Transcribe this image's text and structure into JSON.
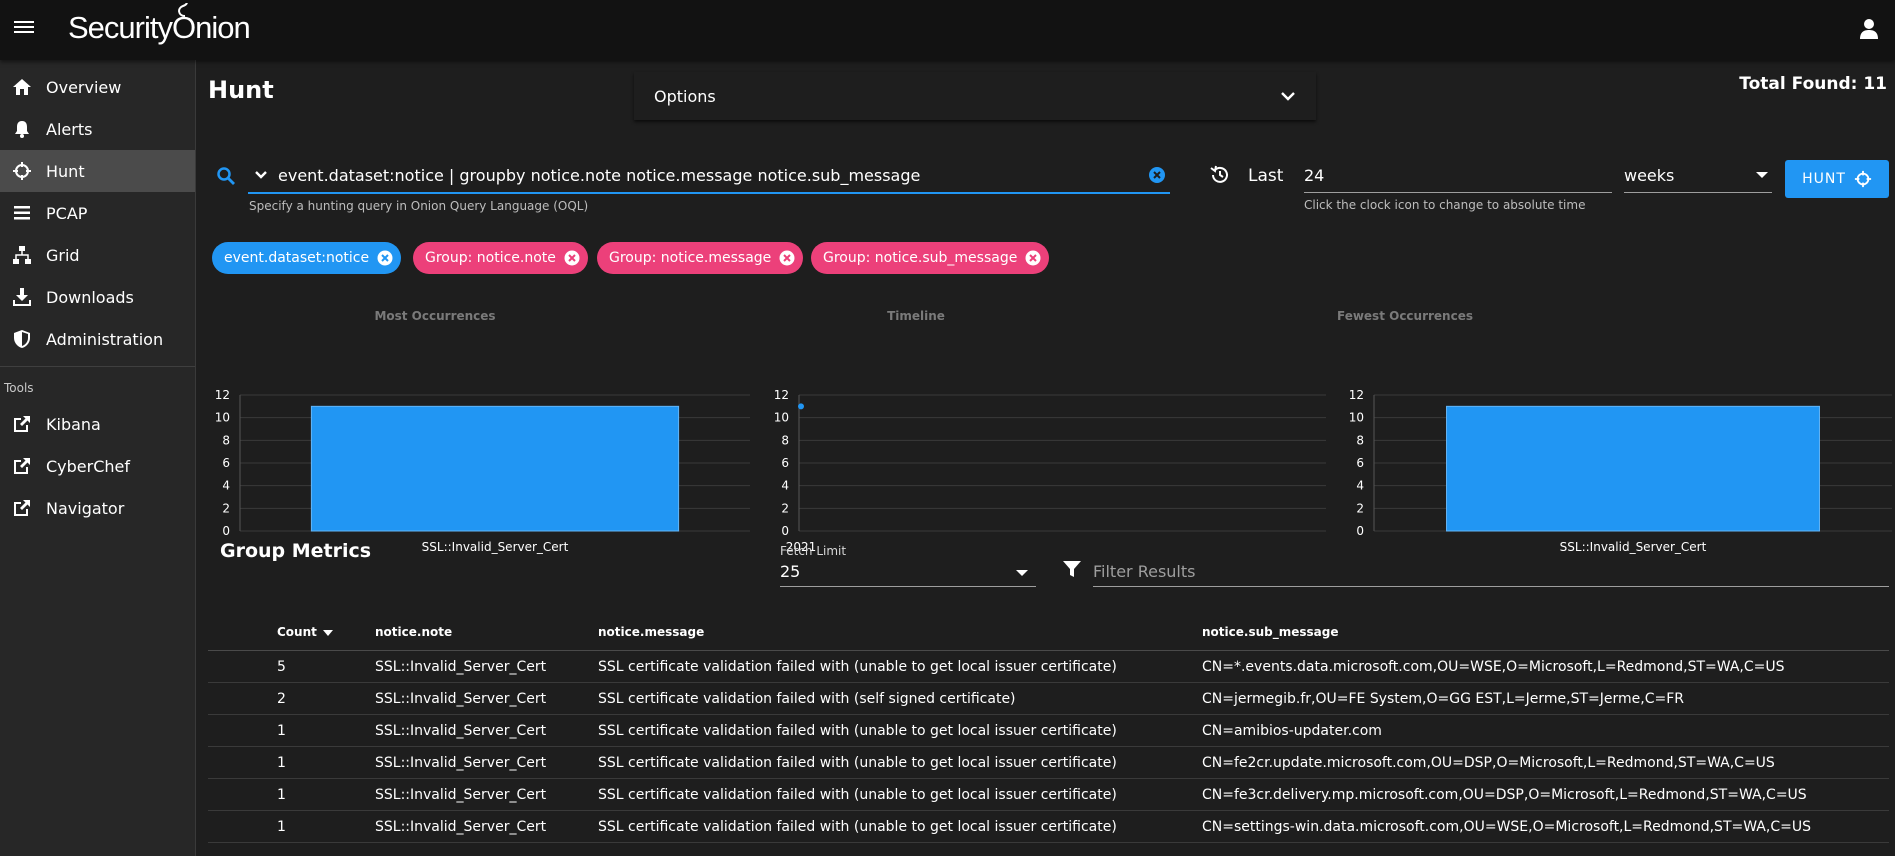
{
  "app": {
    "brand": "Security Onion"
  },
  "sidebar": {
    "items": [
      {
        "label": "Overview"
      },
      {
        "label": "Alerts"
      },
      {
        "label": "Hunt"
      },
      {
        "label": "PCAP"
      },
      {
        "label": "Grid"
      },
      {
        "label": "Downloads"
      },
      {
        "label": "Administration"
      }
    ],
    "tools_header": "Tools",
    "tools": [
      {
        "label": "Kibana"
      },
      {
        "label": "CyberChef"
      },
      {
        "label": "Navigator"
      }
    ]
  },
  "page": {
    "title": "Hunt",
    "options_label": "Options",
    "total_found": "Total Found: 11"
  },
  "query": {
    "value": "event.dataset:notice | groupby notice.note notice.message notice.sub_message",
    "hint": "Specify a hunting query in Onion Query Language (OQL)"
  },
  "time": {
    "last_label": "Last",
    "value": "24",
    "unit": "weeks",
    "hint": "Click the clock icon to change to absolute time",
    "hunt_label": "HUNT"
  },
  "chips": [
    {
      "label": "event.dataset:notice",
      "color": "#2196f3"
    },
    {
      "label": "Group: notice.note",
      "color": "#ec407a"
    },
    {
      "label": "Group: notice.message",
      "color": "#ec407a"
    },
    {
      "label": "Group: notice.sub_message",
      "color": "#ec407a"
    }
  ],
  "chart_data": [
    {
      "type": "bar",
      "title": "Most Occurrences",
      "categories": [
        "SSL::Invalid_Server_Cert"
      ],
      "values": [
        11
      ],
      "ylim": [
        0,
        12
      ],
      "yticks": [
        "0",
        "2",
        "4",
        "6",
        "8",
        "10",
        "12"
      ],
      "color": "#2196f3"
    },
    {
      "type": "scatter",
      "title": "Timeline",
      "x": [
        "2021"
      ],
      "values": [
        11
      ],
      "ylim": [
        0,
        12
      ],
      "yticks": [
        "0",
        "2",
        "4",
        "6",
        "8",
        "10",
        "12"
      ],
      "color": "#2196f3"
    },
    {
      "type": "bar",
      "title": "Fewest Occurrences",
      "categories": [
        "SSL::Invalid_Server_Cert"
      ],
      "values": [
        11
      ],
      "ylim": [
        0,
        12
      ],
      "yticks": [
        "0",
        "2",
        "4",
        "6",
        "8",
        "10",
        "12"
      ],
      "color": "#2196f3"
    }
  ],
  "metrics": {
    "title": "Group Metrics",
    "fetch_label": "Fetch Limit",
    "fetch_value": "25",
    "filter_placeholder": "Filter Results",
    "columns": [
      "Count",
      "notice.note",
      "notice.message",
      "notice.sub_message"
    ],
    "rows": [
      [
        "5",
        "SSL::Invalid_Server_Cert",
        "SSL certificate validation failed with (unable to get local issuer certificate)",
        "CN=*.events.data.microsoft.com,OU=WSE,O=Microsoft,L=Redmond,ST=WA,C=US"
      ],
      [
        "2",
        "SSL::Invalid_Server_Cert",
        "SSL certificate validation failed with (self signed certificate)",
        "CN=jermegib.fr,OU=FE System,O=GG EST,L=Jerme,ST=Jerme,C=FR"
      ],
      [
        "1",
        "SSL::Invalid_Server_Cert",
        "SSL certificate validation failed with (unable to get local issuer certificate)",
        "CN=amibios-updater.com"
      ],
      [
        "1",
        "SSL::Invalid_Server_Cert",
        "SSL certificate validation failed with (unable to get local issuer certificate)",
        "CN=fe2cr.update.microsoft.com,OU=DSP,O=Microsoft,L=Redmond,ST=WA,C=US"
      ],
      [
        "1",
        "SSL::Invalid_Server_Cert",
        "SSL certificate validation failed with (unable to get local issuer certificate)",
        "CN=fe3cr.delivery.mp.microsoft.com,OU=DSP,O=Microsoft,L=Redmond,ST=WA,C=US"
      ],
      [
        "1",
        "SSL::Invalid_Server_Cert",
        "SSL certificate validation failed with (unable to get local issuer certificate)",
        "CN=settings-win.data.microsoft.com,OU=WSE,O=Microsoft,L=Redmond,ST=WA,C=US"
      ]
    ]
  }
}
